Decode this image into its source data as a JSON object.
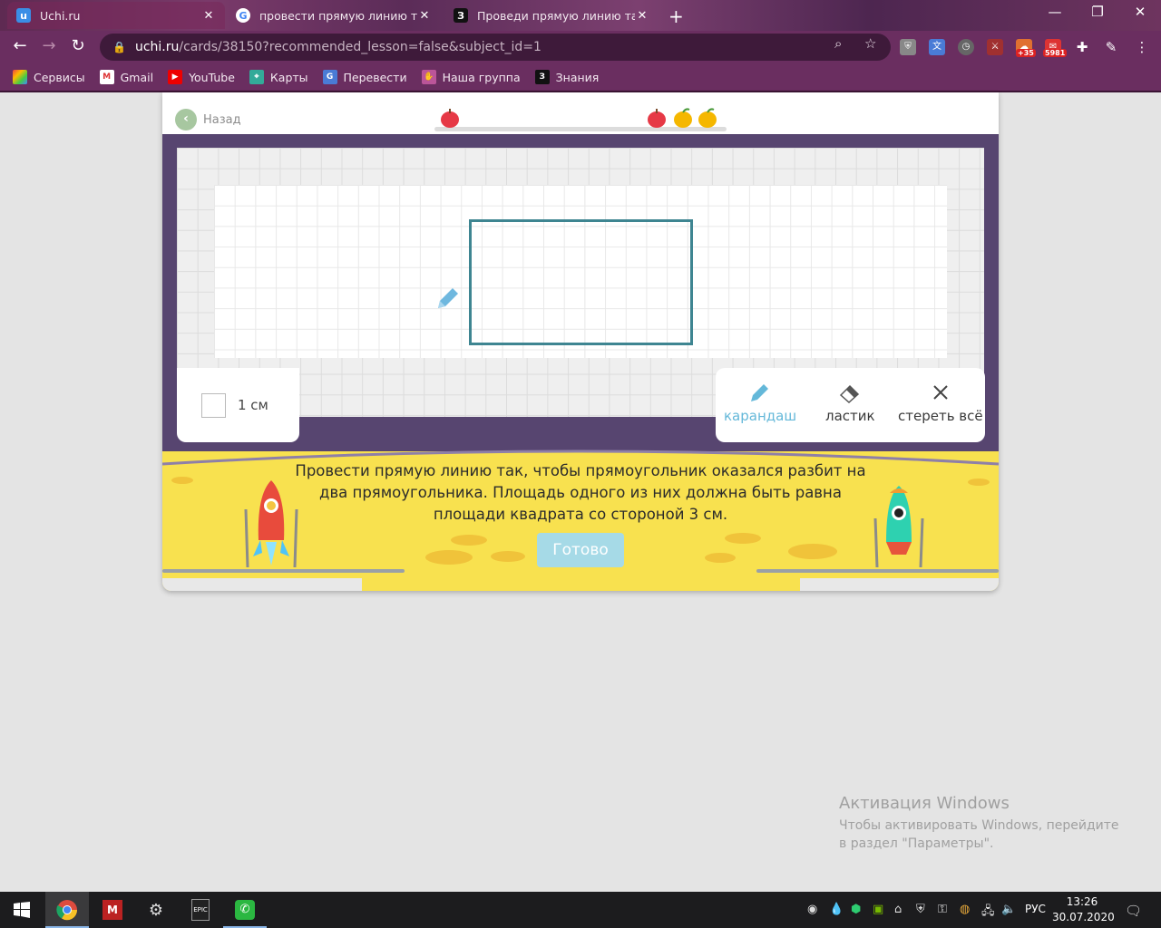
{
  "browser": {
    "tabs": [
      {
        "title": "Uchi.ru",
        "active": true
      },
      {
        "title": "провести прямую линию так чт",
        "active": false
      },
      {
        "title": "Проведи прямую линию так, чт",
        "active": false
      }
    ],
    "url_host": "uchi.ru",
    "url_path": "/cards/38150?recommended_lesson=false&subject_id=1",
    "extension_badges": [
      "+35",
      "5981"
    ],
    "bookmarks": [
      "Сервисы",
      "Gmail",
      "YouTube",
      "Карты",
      "Перевести",
      "Наша группа",
      "Знания"
    ]
  },
  "lesson": {
    "back_label": "Назад",
    "scale_label": "1 см",
    "tools": {
      "pencil": "карандаш",
      "eraser": "ластик",
      "clear": "стереть всё"
    },
    "task_text": "Провести прямую линию так, чтобы прямоугольник оказался разбит на два прямоугольника. Площадь одного из них должна быть равна площади квадрата со стороной 3 см.",
    "done_label": "Готово",
    "colors": {
      "accent": "#64b8d9",
      "frame": "#574570",
      "moon": "#f8e14f",
      "shape": "#3e8591"
    }
  },
  "watermark": {
    "title": "Активация Windows",
    "text": "Чтобы активировать Windows, перейдите в раздел \"Параметры\"."
  },
  "taskbar": {
    "lang": "РУС",
    "time": "13:26",
    "date": "30.07.2020"
  }
}
